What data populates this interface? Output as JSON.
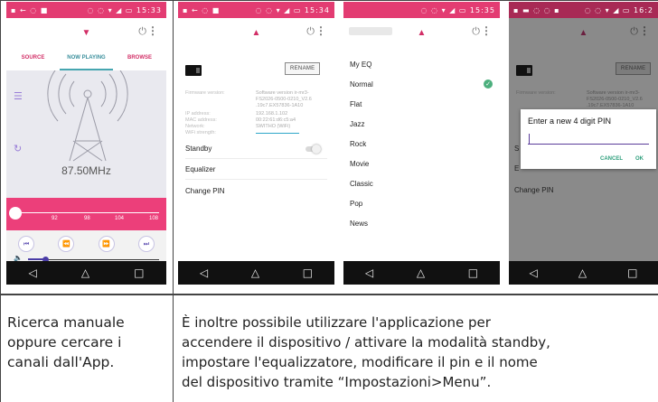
{
  "screen1": {
    "status_left": "▪ ← ◌ ■",
    "status_right": "◌ ◌ ▾ ◢ ▭ 15:33",
    "tabs": [
      "SOURCE",
      "NOW PLAYING",
      "BROWSE"
    ],
    "frequency": "87.50MHz",
    "scale_labels": [
      "92",
      "98",
      "104",
      "108"
    ],
    "tuner_progress": 0.0
  },
  "screen2": {
    "status_left": "▪ ← ◌ ■",
    "status_right": "◌ ◌ ▾ ◢ ▭ 15:34",
    "rename_label": "RENAME",
    "info_keys": [
      "Firmware version:",
      "",
      "",
      "IP address:",
      "MAC address:",
      "Network:",
      "WiFi strength:"
    ],
    "info_values": [
      "Software version ir-mr3-",
      "FS2026-0500-0210_V2.6",
      ".19c7.EX57836-1A10",
      "192.168.1.102",
      "00:22:61:d6:c5:a4",
      "SWITHO (WiFi)",
      ""
    ],
    "menu": [
      "Standby",
      "Equalizer",
      "Change PIN"
    ]
  },
  "screen3": {
    "status_right": "◌ ◌ ▾ ◢ ▭ 15:35",
    "eq_items": [
      "My EQ",
      "Normal",
      "Flat",
      "Jazz",
      "Rock",
      "Movie",
      "Classic",
      "Pop",
      "News"
    ],
    "selected_index": 1
  },
  "screen4": {
    "status_left": "▪ ▬ ◌ ◌ ▪",
    "status_right": "◌ ◌ ▾ ◢ ▭ 16:2",
    "dialog_title": "Enter a new 4 digit PIN",
    "cancel_label": "CANCEL",
    "ok_label": "OK",
    "rename_label": "RENAME",
    "info_keys": [
      "Firmware version:"
    ],
    "info_values": [
      "Software version ir-mr3-",
      "FS2026-0500-0210_V2.6",
      ".19c7.EX57836-1A10"
    ],
    "menu_partial": [
      "S",
      "E",
      "Change PIN"
    ]
  },
  "nav": {
    "back": "◁",
    "home": "△",
    "recent": "□"
  },
  "caption_left": [
    "Ricerca manuale",
    "oppure cercare i",
    "canali dall'App."
  ],
  "caption_right": [
    "È inoltre possibile utilizzare l'applicazione per",
    "accendere il dispositivo / attivare la modalità standby,",
    "impostare l'equalizzatore, modificare il pin e il nome",
    "del dispositivo tramite  “Impostazioni>Menu”."
  ]
}
